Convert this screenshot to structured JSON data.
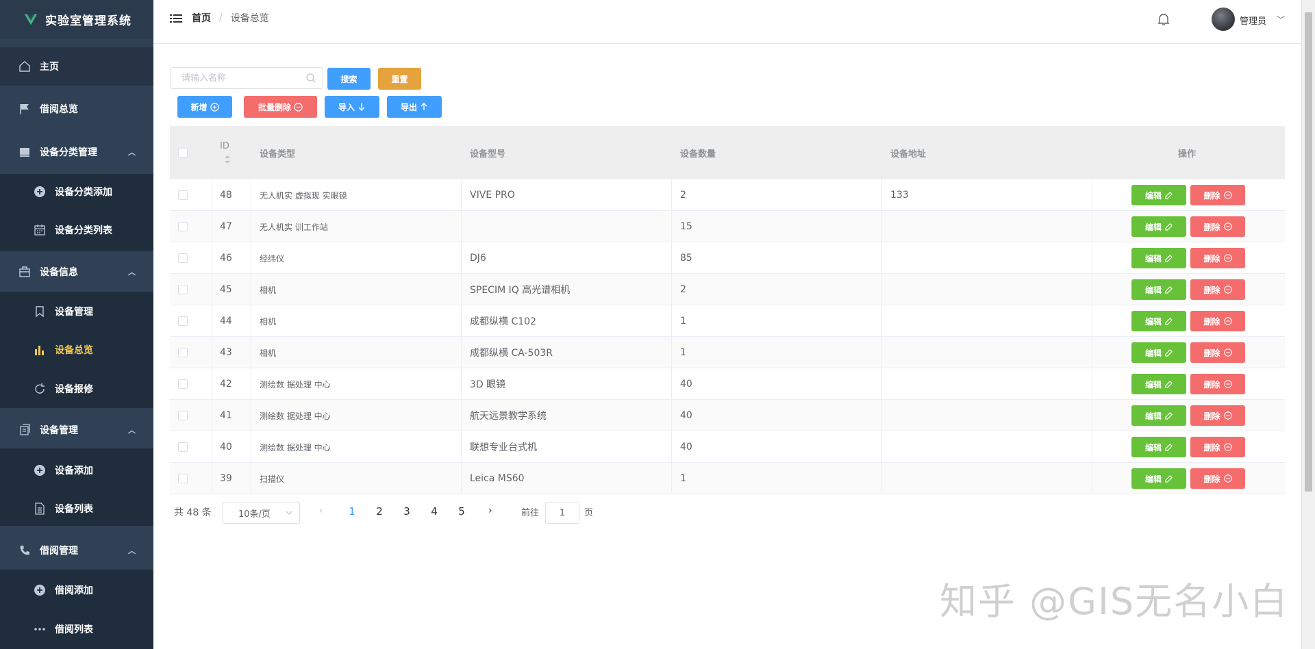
{
  "app": {
    "title": "实验室管理系统"
  },
  "sidebar": {
    "items": [
      {
        "label": "主页",
        "icon": "home-icon"
      },
      {
        "label": "借阅总览",
        "icon": "flag-icon"
      },
      {
        "label": "设备分类管理",
        "icon": "folder-icon"
      },
      {
        "label": "设备分类添加",
        "icon": "plus-circle-icon"
      },
      {
        "label": "设备分类列表",
        "icon": "calendar-icon"
      },
      {
        "label": "设备信息",
        "icon": "briefcase-icon"
      },
      {
        "label": "设备管理",
        "icon": "bookmark-icon"
      },
      {
        "label": "设备总览",
        "icon": "bar-chart-icon"
      },
      {
        "label": "设备报修",
        "icon": "refresh-icon"
      },
      {
        "label": "设备管理",
        "icon": "documents-icon"
      },
      {
        "label": "设备添加",
        "icon": "plus-circle-icon"
      },
      {
        "label": "设备列表",
        "icon": "document-icon"
      },
      {
        "label": "借阅管理",
        "icon": "phone-icon"
      },
      {
        "label": "借阅添加",
        "icon": "plus-circle-icon"
      },
      {
        "label": "借阅列表",
        "icon": "more-icon"
      }
    ]
  },
  "header": {
    "breadcrumb_home": "首页",
    "breadcrumb_sep": "/",
    "breadcrumb_current": "设备总览",
    "user_name": "管理员"
  },
  "toolbar": {
    "search_placeholder": "请输入名称",
    "search_label": "搜索",
    "reset_label": "重置",
    "add_label": "新增",
    "batch_delete_label": "批量删除",
    "import_label": "导入",
    "export_label": "导出"
  },
  "table": {
    "columns": [
      "ID",
      "设备类型",
      "设备型号",
      "设备数量",
      "设备地址",
      "操作"
    ],
    "edit_label": "编辑",
    "delete_label": "删除",
    "rows": [
      {
        "id": "48",
        "type": "无人机实 虚拟现 实眼镜",
        "model": "VIVE PRO",
        "qty": "2",
        "addr": "133"
      },
      {
        "id": "47",
        "type": "无人机实 训工作站",
        "model": "",
        "qty": "15",
        "addr": ""
      },
      {
        "id": "46",
        "type": "经纬仪",
        "model": "DJ6",
        "qty": "85",
        "addr": ""
      },
      {
        "id": "45",
        "type": "相机",
        "model": "SPECIM IQ 高光谱相机",
        "qty": "2",
        "addr": ""
      },
      {
        "id": "44",
        "type": "相机",
        "model": "成都纵横 C102",
        "qty": "1",
        "addr": ""
      },
      {
        "id": "43",
        "type": "相机",
        "model": "成都纵横 CA-503R",
        "qty": "1",
        "addr": ""
      },
      {
        "id": "42",
        "type": "测绘数 据处理 中心",
        "model": "3D 眼镜",
        "qty": "40",
        "addr": ""
      },
      {
        "id": "41",
        "type": "测绘数 据处理 中心",
        "model": "航天远景教学系统",
        "qty": "40",
        "addr": ""
      },
      {
        "id": "40",
        "type": "测绘数 据处理 中心",
        "model": "联想专业台式机",
        "qty": "40",
        "addr": ""
      },
      {
        "id": "39",
        "type": "扫描仪",
        "model": "Leica MS60",
        "qty": "1",
        "addr": ""
      }
    ]
  },
  "pagination": {
    "total_text": "共 48 条",
    "page_size": "10条/页",
    "pages": [
      "1",
      "2",
      "3",
      "4",
      "5"
    ],
    "current_page": "1",
    "goto_label": "前往",
    "goto_value": "1",
    "page_suffix": "页"
  },
  "watermark": "知乎 @GIS无名小白",
  "colors": {
    "sidebar_bg": "#304156",
    "active_text": "#f6c94a",
    "primary": "#409eff",
    "warning": "#e6a23c",
    "danger": "#f56c6c",
    "success": "#67c23a"
  }
}
